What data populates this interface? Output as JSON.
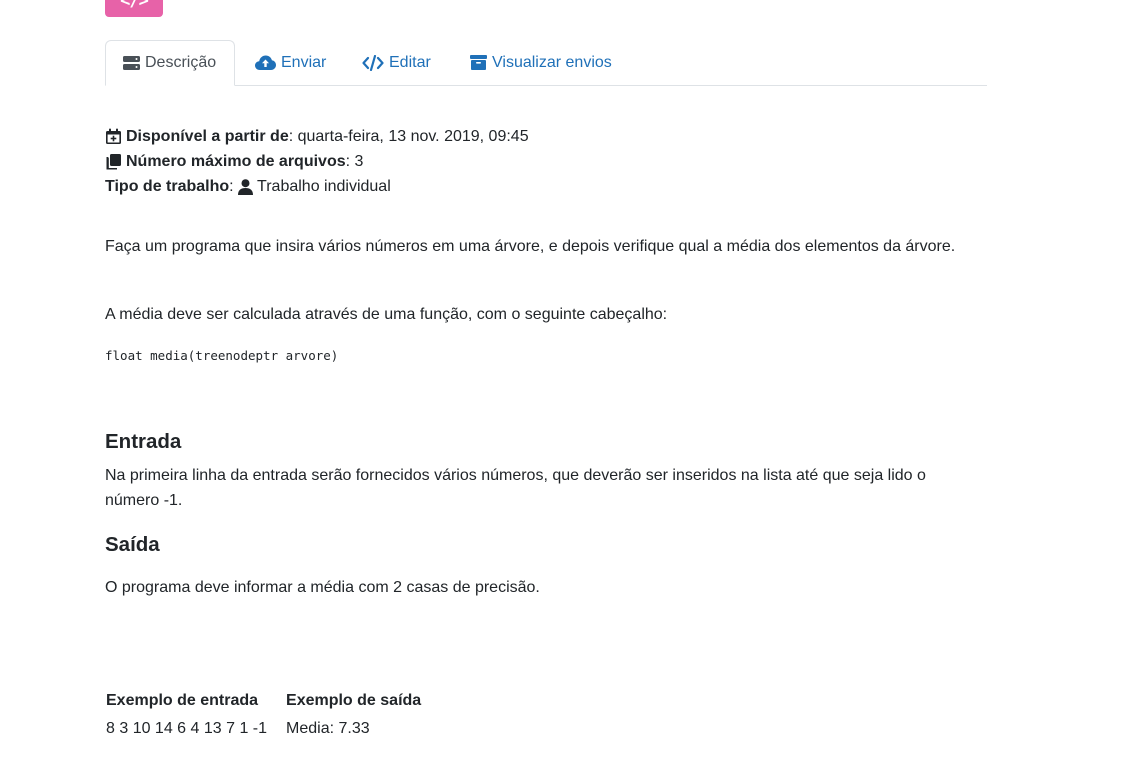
{
  "logo": {
    "text": "</>"
  },
  "tabs": [
    {
      "label": "Descrição",
      "icon": "server-icon",
      "active": true
    },
    {
      "label": "Enviar",
      "icon": "cloud-upload-icon",
      "active": false
    },
    {
      "label": "Editar",
      "icon": "code-icon",
      "active": false
    },
    {
      "label": "Visualizar envios",
      "icon": "archive-icon",
      "active": false
    }
  ],
  "meta": {
    "available_label": "Disponível a partir de",
    "available_value": ": quarta-feira, 13 nov. 2019, 09:45",
    "max_files_label": "Número máximo de arquivos",
    "max_files_value": ": 3",
    "work_type_label": "Tipo de trabalho",
    "work_type_sep": ": ",
    "work_type_value": "Trabalho individual"
  },
  "description": {
    "paragraph1": "Faça um programa que insira vários números em uma árvore, e depois verifique qual a média dos elementos da árvore.",
    "paragraph2": "A média deve ser calculada através de uma função, com o seguinte cabeçalho:",
    "code": "float media(treenodeptr arvore)"
  },
  "input_section": {
    "heading": "Entrada",
    "text": "Na primeira linha da entrada serão fornecidos vários números, que deverão ser inseridos na lista até que seja lido o número -1."
  },
  "output_section": {
    "heading": "Saída",
    "text": "O programa deve informar a média com 2 casas de precisão."
  },
  "examples": {
    "headers": [
      "Exemplo de entrada",
      "Exemplo de saída"
    ],
    "rows": [
      [
        "8 3 10 14 6 4 13 7 1 -1",
        "Media: 7.33"
      ]
    ]
  },
  "colors": {
    "link": "#1f70b8",
    "logo_bg": "#e762a8",
    "text": "#212529",
    "tab_border": "#dee2e6"
  }
}
